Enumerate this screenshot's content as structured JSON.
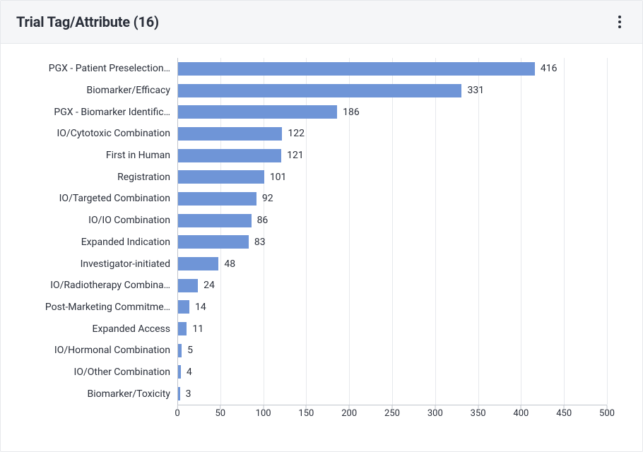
{
  "header": {
    "title": "Trial Tag/Attribute (16)"
  },
  "chart_data": {
    "type": "bar",
    "orientation": "horizontal",
    "title": "Trial Tag/Attribute (16)",
    "xlabel": "",
    "ylabel": "",
    "xlim": [
      0,
      500
    ],
    "x_ticks": [
      0,
      50,
      100,
      150,
      200,
      250,
      300,
      350,
      400,
      450,
      500
    ],
    "bar_color": "#6f95d7",
    "categories": [
      "PGX - Patient Preselection…",
      "Biomarker/Efficacy",
      "PGX - Biomarker Identific…",
      "IO/Cytotoxic Combination",
      "First in Human",
      "Registration",
      "IO/Targeted Combination",
      "IO/IO Combination",
      "Expanded Indication",
      "Investigator-initiated",
      "IO/Radiotherapy Combina…",
      "Post-Marketing Commitme…",
      "Expanded Access",
      "IO/Hormonal Combination",
      "IO/Other Combination",
      "Biomarker/Toxicity"
    ],
    "values": [
      416,
      331,
      186,
      122,
      121,
      101,
      92,
      86,
      83,
      48,
      24,
      14,
      11,
      5,
      4,
      3
    ]
  }
}
